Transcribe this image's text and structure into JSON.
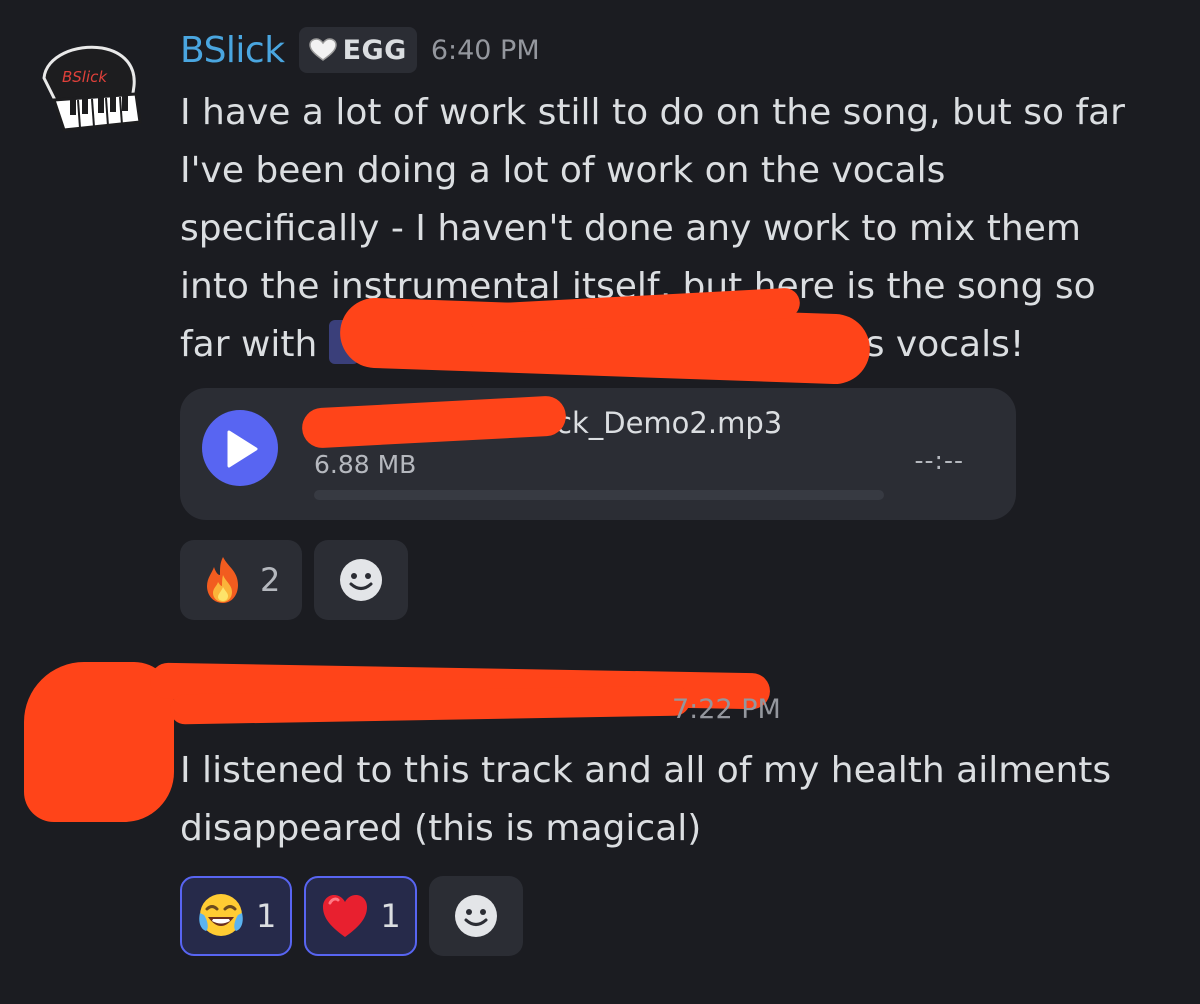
{
  "message1": {
    "author": "BSlick",
    "tag": "EGG",
    "timestamp": "6:40 PM",
    "body_lines": [
      "I have a lot of work still to do on the song, but so far",
      "I've been doing a lot of work on the vocals",
      "specifically - I haven't done any work to mix them",
      "into the instrumental itself, but here is the song so",
      "far with"
    ],
    "body_tail": "s vocals!",
    "avatar_label": "BSlick",
    "attachment": {
      "file_name": "ck_Demo2.mp3",
      "file_size": "6.88 MB",
      "duration": "--:--",
      "progress": 0
    },
    "reactions": [
      {
        "emoji": "fire-emoji",
        "count": "2",
        "active": false
      }
    ]
  },
  "message2": {
    "timestamp": "7:22 PM",
    "body_lines": [
      "I listened to this track and all of my health ailments",
      "disappeared (this is magical)"
    ],
    "reactions": [
      {
        "emoji": "tears-of-joy-emoji",
        "count": "1",
        "active": true
      },
      {
        "emoji": "red-heart-emoji",
        "count": "1",
        "active": true
      }
    ]
  },
  "icons": {
    "play": "play-icon",
    "add_reaction": "smiley-icon"
  },
  "colors": {
    "background": "#1b1c21",
    "username": "#4aa6e0",
    "accent": "#5865f2",
    "redaction": "#ff4419"
  }
}
